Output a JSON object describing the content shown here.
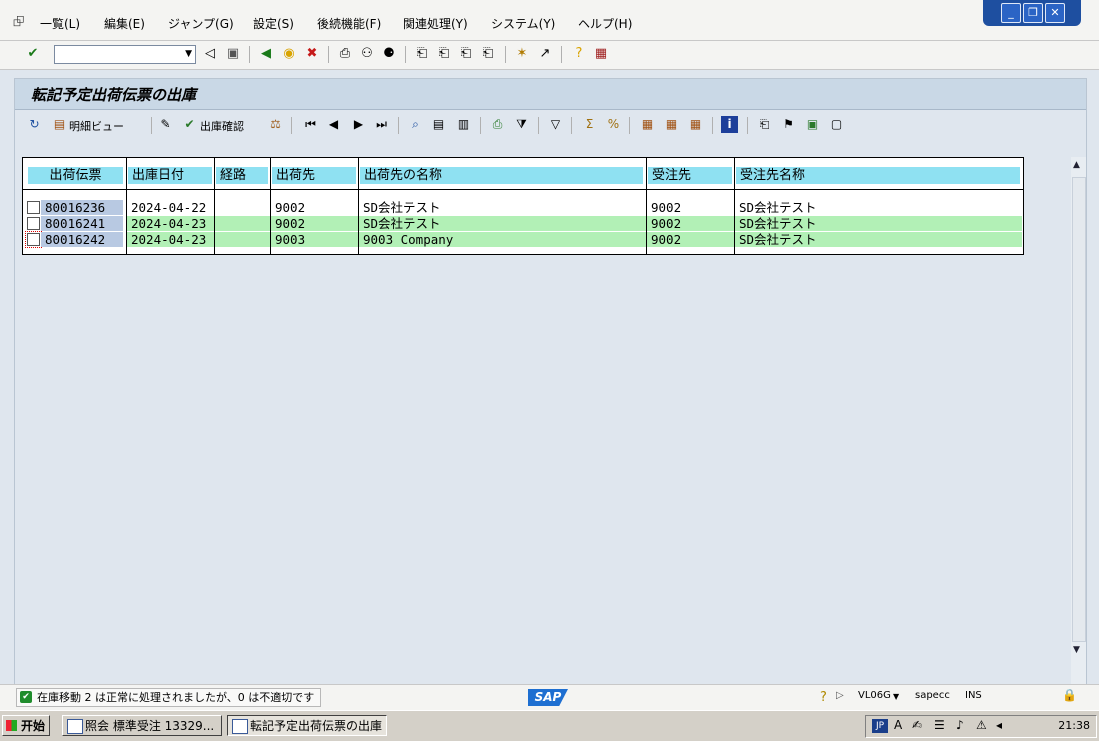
{
  "menubar": {
    "items": [
      "一覧(L)",
      "編集(E)",
      "ジャンプ(G)",
      "設定(S)",
      "後続機能(F)",
      "関連処理(Y)",
      "システム(Y)",
      "ヘルプ(H)"
    ]
  },
  "window_controls": {
    "minimize": "_",
    "restore": "❐",
    "close": "✕"
  },
  "command_field": {
    "value": "",
    "placeholder": ""
  },
  "screen": {
    "title": "転記予定出荷伝票の出庫",
    "app_toolbar": {
      "detail_view_label": "明細ビュー",
      "goods_issue_label": "出庫確認"
    }
  },
  "table": {
    "columns": [
      "出荷伝票",
      "出庫日付",
      "経路",
      "出荷先",
      "出荷先の名称",
      "受注先",
      "受注先名称"
    ],
    "rows": [
      {
        "doc": "80016236",
        "date": "2024-04-22",
        "route": "",
        "ship_to": "9002",
        "ship_to_name": "SD会社テスト",
        "sold_to": "9002",
        "sold_to_name": "SD会社テスト",
        "highlight": false
      },
      {
        "doc": "80016241",
        "date": "2024-04-23",
        "route": "",
        "ship_to": "9002",
        "ship_to_name": "SD会社テスト",
        "sold_to": "9002",
        "sold_to_name": "SD会社テスト",
        "highlight": true
      },
      {
        "doc": "80016242",
        "date": "2024-04-23",
        "route": "",
        "ship_to": "9003",
        "ship_to_name": "9003 Company",
        "sold_to": "9002",
        "sold_to_name": "SD会社テスト",
        "highlight": true
      }
    ]
  },
  "statusbar": {
    "message": "在庫移動 2 は正常に処理されましたが、0 は不適切です",
    "sap_logo": "SAP",
    "transaction": "VL06G",
    "server": "sapecc",
    "mode": "INS"
  },
  "taskbar": {
    "start_label": "开始",
    "tasks": [
      "照会 標準受注 13329...",
      "転記予定出荷伝票の出庫"
    ],
    "lang": "JP",
    "clock": "21:38"
  },
  "colors": {
    "header_cyan": "#8fe1f2",
    "row_green": "#b2f0b6",
    "doc_blue": "#b8c9e2",
    "titlebar": "#c9d8e6"
  }
}
